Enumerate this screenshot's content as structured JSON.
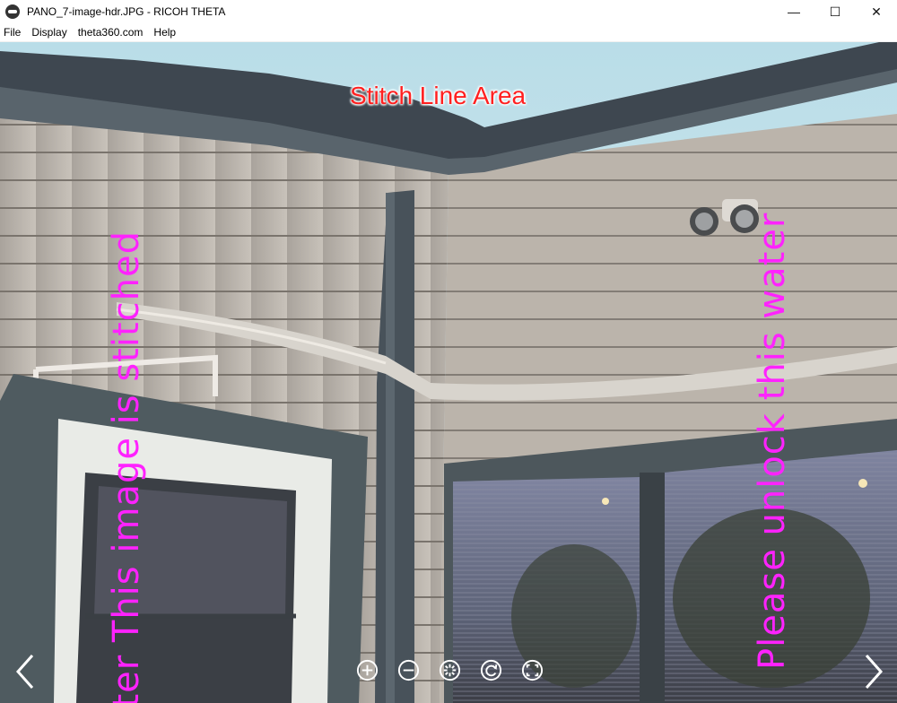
{
  "window": {
    "title": "PANO_7-image-hdr.JPG - RICOH THETA",
    "controls": {
      "minimize": "—",
      "maximize": "☐",
      "close": "✕"
    }
  },
  "menu": {
    "items": [
      {
        "label": "File"
      },
      {
        "label": "Display"
      },
      {
        "label": "theta360.com"
      },
      {
        "label": "Help"
      }
    ]
  },
  "viewer": {
    "stitch_label": "Stitch Line Area",
    "watermark_left": "rter This image is stitched",
    "watermark_right": "Please unlock this water",
    "nav": {
      "prev_icon": "chevron-left-icon",
      "next_icon": "chevron-right-icon"
    },
    "toolbar": [
      {
        "icon": "zoom-in-icon"
      },
      {
        "icon": "zoom-out-icon"
      },
      {
        "icon": "auto-rotate-icon"
      },
      {
        "icon": "reset-view-icon"
      },
      {
        "icon": "fullscreen-icon"
      }
    ]
  },
  "colors": {
    "watermark": "#ff22ff",
    "stitch_label": "#ff2020",
    "siding": "#b8b0a8",
    "trim": "#4a5256"
  }
}
